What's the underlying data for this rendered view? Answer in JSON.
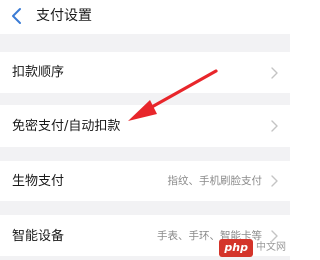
{
  "header": {
    "title": "支付设置",
    "back_icon": "chevron-left-icon",
    "accent_color": "#3a7bd5"
  },
  "settings": [
    {
      "id": "deduct-order",
      "label": "扣款顺序",
      "hint": ""
    },
    {
      "id": "passwordless-autopay",
      "label": "免密支付/自动扣款",
      "hint": ""
    },
    {
      "id": "biometric-pay",
      "label": "生物支付",
      "hint": "指纹、手机刷脸支付"
    },
    {
      "id": "smart-devices",
      "label": "智能设备",
      "hint": "手表、手环、智能卡等"
    }
  ],
  "annotation": {
    "arrow_color": "#e8262b",
    "target": "passwordless-autopay"
  },
  "watermark": {
    "badge": "php",
    "text": "中文网"
  }
}
